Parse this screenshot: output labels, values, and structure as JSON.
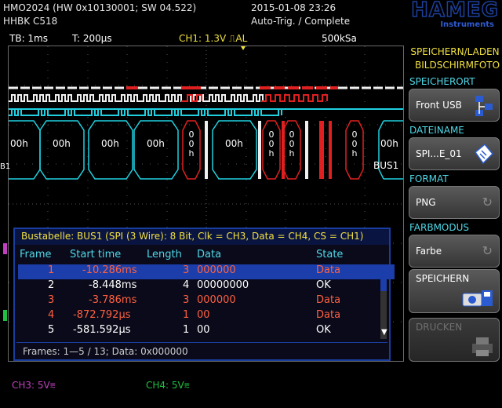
{
  "header": {
    "device": "HMO2024 (HW 0x10130001; SW 04.522)",
    "probe": "HHBK C518",
    "datetime": "2015-01-08 23:26",
    "trigger_status": "Auto-Trig. / Complete",
    "brand": "HAMEG",
    "brand_sub": "Instruments"
  },
  "status": {
    "timebase": "TB: 1ms",
    "trigger_time": "T: 200µs",
    "ch1": "CH1: 1.3V ⎍AL",
    "sample_rate": "500kSa"
  },
  "waveform": {
    "bus_values": [
      "00h",
      "00h",
      "00h",
      "00h",
      "0 0 h",
      "00h",
      "0 0 h",
      "0 0 h",
      "0 0 h",
      "00h"
    ],
    "bus_label": "BUS1",
    "left_marker": "B1"
  },
  "menu": {
    "title_line1": "SPEICHERN/LADEN",
    "title_line2": "BILDSCHIRMFOTO",
    "speicherort_label": "SPEICHERORT",
    "speicherort_value": "Front USB",
    "dateiname_label": "DATEINAME",
    "dateiname_value": "SPI...E_01",
    "format_label": "FORMAT",
    "format_value": "PNG",
    "farbmodus_label": "FARBMODUS",
    "farbmodus_value": "Farbe",
    "speichern_label": "SPEICHERN",
    "drucken_label": "DRUCKEN"
  },
  "bus_table": {
    "title": "Bustabelle: BUS1 (SPI (3 Wire): 8 Bit, Clk = CH3, Data = CH4, CS = CH1)",
    "columns": [
      "Frame",
      "Start time",
      "Length",
      "Data",
      "State"
    ],
    "rows": [
      {
        "frame": "1",
        "start": "-10.286ms",
        "length": "3",
        "data": "000000",
        "state": "Data"
      },
      {
        "frame": "2",
        "start": "-8.448ms",
        "length": "4",
        "data": "00000000",
        "state": "OK"
      },
      {
        "frame": "3",
        "start": "-3.786ms",
        "length": "3",
        "data": "000000",
        "state": "Data"
      },
      {
        "frame": "4",
        "start": "-872.792µs",
        "length": "1",
        "data": "00",
        "state": "Data"
      },
      {
        "frame": "5",
        "start": "-581.592µs",
        "length": "1",
        "data": "00",
        "state": "OK"
      }
    ],
    "footer": "Frames: 1—5 / 13; Data: 0x000000"
  },
  "channels": {
    "ch3": "CH3: 5V⩳",
    "ch4": "CH4: 5V⩳"
  },
  "colors": {
    "ch1": "#f0e040",
    "ch3": "#c040c0",
    "ch4": "#20c040",
    "bus": "#20d0e0",
    "error": "#e02020",
    "selection": "#1b3eab"
  }
}
